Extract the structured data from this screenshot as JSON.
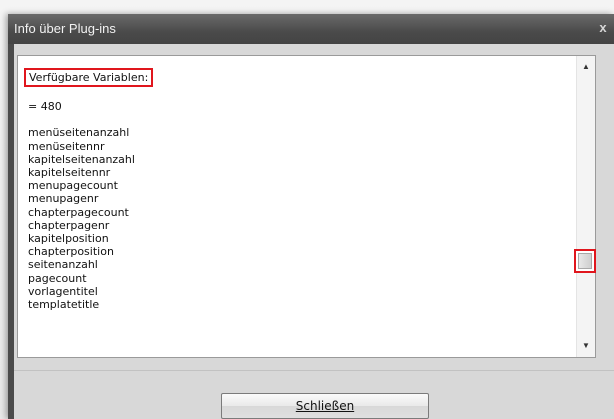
{
  "window": {
    "title": "Info über Plug-ins",
    "close_glyph": "x"
  },
  "content": {
    "heading": "Verfügbare Variablen:",
    "count_line": "= 480",
    "variables": [
      "menüseitenanzahl",
      "menüseitennr",
      "kapitelseitenanzahl",
      "kapitelseitennr",
      "menupagecount",
      "menupagenr",
      "chapterpagecount",
      "chapterpagenr",
      "kapitelposition",
      "chapterposition",
      "seitenanzahl",
      "pagecount",
      "vorlagentitel",
      "templatetitle"
    ]
  },
  "scrollbar": {
    "up_icon": "▲",
    "down_icon": "▼",
    "position_fraction": 0.7
  },
  "footer": {
    "close_button_label": "Schließen"
  },
  "colors": {
    "highlight": "#e0161d",
    "titlebar": "#4a4a4a",
    "client_bg": "#d8d8d8"
  }
}
